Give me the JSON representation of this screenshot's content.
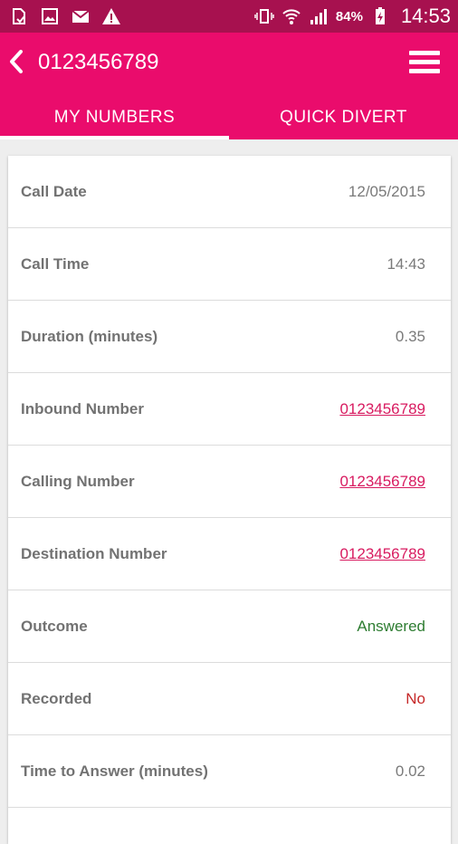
{
  "status_bar": {
    "battery": "84%",
    "time": "14:53",
    "icons": [
      "sim-notification-icon",
      "image-notification-icon",
      "mail-icon",
      "warning-icon",
      "vibrate-icon",
      "wifi-icon",
      "signal-icon",
      "battery-charging-icon"
    ],
    "color": "#a7114f"
  },
  "header": {
    "title": "0123456789",
    "back_icon": "chevron-left-icon",
    "menu_icon": "hamburger-menu-icon",
    "color": "#ea0c6c"
  },
  "tabs": [
    {
      "label": "MY NUMBERS",
      "active": true
    },
    {
      "label": "QUICK DIVERT",
      "active": false
    }
  ],
  "details": {
    "rows": [
      {
        "label": "Call Date",
        "value": "12/05/2015",
        "style": "plain"
      },
      {
        "label": "Call Time",
        "value": "14:43",
        "style": "plain"
      },
      {
        "label": "Duration (minutes)",
        "value": "0.35",
        "style": "plain"
      },
      {
        "label": "Inbound Number",
        "value": "0123456789",
        "style": "link"
      },
      {
        "label": "Calling Number",
        "value": "0123456789",
        "style": "link"
      },
      {
        "label": "Destination Number",
        "value": "0123456789",
        "style": "link"
      },
      {
        "label": "Outcome",
        "value": "Answered",
        "style": "success"
      },
      {
        "label": "Recorded",
        "value": "No",
        "style": "negative"
      },
      {
        "label": "Time to Answer (minutes)",
        "value": "0.02",
        "style": "plain"
      }
    ]
  },
  "colors": {
    "link": "#d81b60",
    "success": "#2e7d32",
    "negative": "#c62828",
    "label": "#727272",
    "value": "#7a7a7a"
  }
}
